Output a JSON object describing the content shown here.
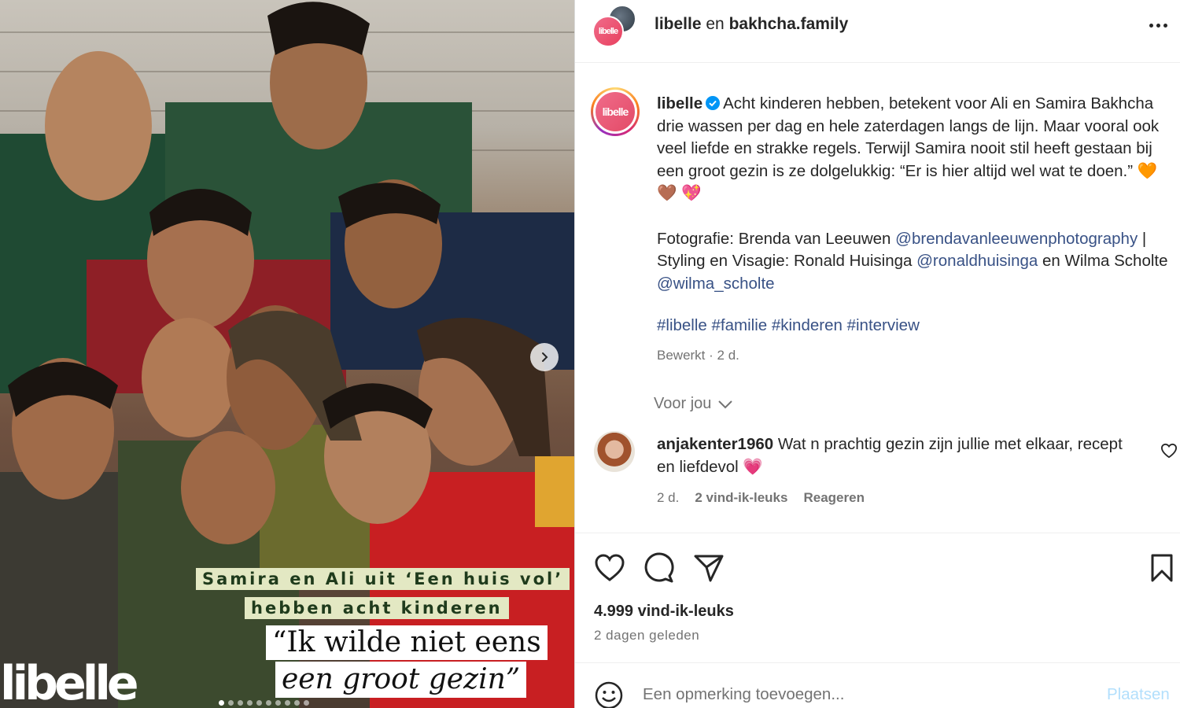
{
  "photo": {
    "caption_line1": "Samira en Ali uit ‘Een huis vol’",
    "caption_line2": "hebben acht kinderen",
    "quote_line1": "“Ik wilde niet eens",
    "quote_line2": "een groot gezin”",
    "logo": "libelle",
    "slide_count": 10,
    "active_slide": 1
  },
  "header": {
    "account1": "libelle",
    "connector": "en",
    "account2": "bakhcha.family",
    "avatar_text": "libelle"
  },
  "caption": {
    "avatar_text": "libelle",
    "username": "libelle",
    "text1": "Acht kinderen hebben, betekent voor Ali en Samira Bakhcha drie wassen per dag en hele zaterdagen langs de lijn. Maar vooral ook veel liefde en strakke regels. Terwijl Samira nooit stil heeft gestaan bij een groot gezin is ze dolgelukkig: “Er is hier altijd wel wat te doen.”",
    "emojis1": "🧡 🤎 💖",
    "photo_prefix": "Fotografie: Brenda van Leeuwen",
    "photo_mention": "@brendavanleeuwenphotography",
    "sep": "|",
    "styling_prefix": "Styling en Visagie: Ronald Huisinga",
    "styling_mention": "@ronaldhuisinga",
    "and_text": "en Wilma Scholte",
    "wilma_mention": "@wilma_scholte",
    "hashtags": "#libelle #familie #kinderen #interview",
    "edited": "Bewerkt · 2 d."
  },
  "for_you": "Voor jou",
  "comment": {
    "username": "anjakenter1960",
    "text": "Wat n prachtig gezin zijn jullie met elkaar, recept en liefdevol",
    "emoji": "💗",
    "age": "2 d.",
    "likes": "2 vind-ik-leuks",
    "reply": "Reageren"
  },
  "post": {
    "likes": "4.999 vind-ik-leuks",
    "posted": "2 dagen geleden"
  },
  "comment_box": {
    "placeholder": "Een opmerking toevoegen...",
    "post_label": "Plaatsen"
  },
  "colors": {
    "link": "#385185",
    "muted": "#737373",
    "post_disabled": "#b2dffc",
    "brand_pink": "#e8405f"
  },
  "icons": [
    "chevron-right-icon",
    "more-icon",
    "verified-icon",
    "chevron-down-icon",
    "heart-icon",
    "comment-icon",
    "share-icon",
    "bookmark-icon",
    "emoji-icon"
  ]
}
